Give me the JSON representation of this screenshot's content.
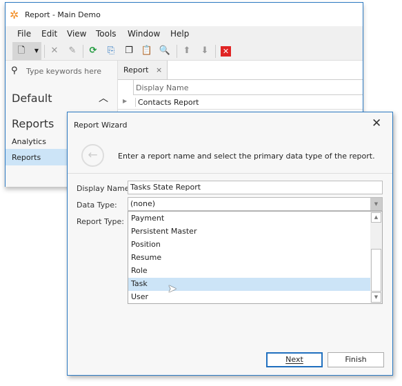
{
  "window": {
    "title": "Report - Main Demo",
    "brand_color": "#f28a1e",
    "accent": "#2b79c2"
  },
  "menu": [
    "File",
    "Edit",
    "View",
    "Tools",
    "Window",
    "Help"
  ],
  "toolbar": {
    "icons": [
      "new-icon",
      "dropdown-icon",
      "delete-icon",
      "edit-icon",
      "refresh-icon",
      "export-icon",
      "copy-icon",
      "paste-icon",
      "preview-icon",
      "up-icon",
      "down-icon",
      "close-red-icon"
    ]
  },
  "sidebar": {
    "search_placeholder": "Type keywords here",
    "group1": "Default",
    "group2": "Reports",
    "items": [
      {
        "label": "Analytics"
      },
      {
        "label": "Reports",
        "selected": true
      }
    ]
  },
  "content": {
    "tab": "Report",
    "column": "Display Name",
    "rows": [
      "Contacts Report"
    ]
  },
  "dialog": {
    "title": "Report Wizard",
    "instruction": "Enter a report name and select the primary data type of the report.",
    "display_name_label": "Display Name:",
    "display_name_value": "Tasks State Report",
    "data_type_label": "Data Type:",
    "data_type_value": "(none)",
    "report_type_label": "Report Type:",
    "options": [
      "Payment",
      "Persistent Master",
      "Position",
      "Resume",
      "Role",
      "Task",
      "User"
    ],
    "hovered_option": "Task",
    "next_label": "Next",
    "finish_label": "Finish"
  }
}
